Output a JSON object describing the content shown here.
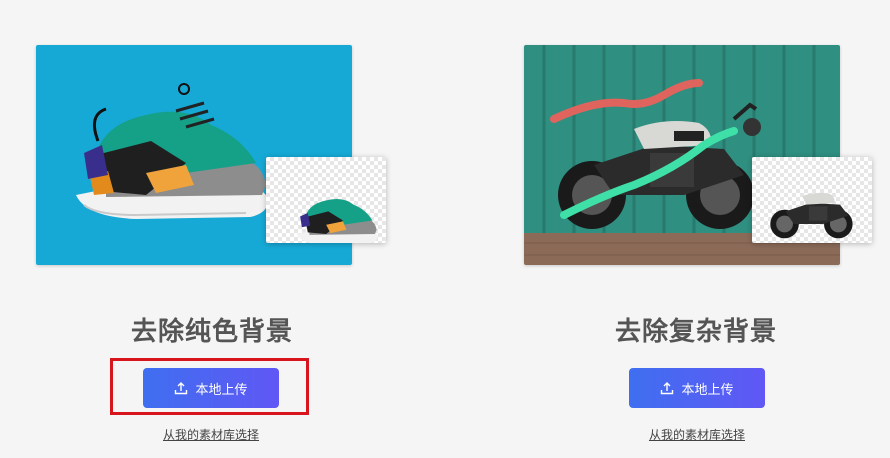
{
  "sections": [
    {
      "title": "去除纯色背景",
      "upload_label": "本地上传",
      "library_link": "从我的素材库选择"
    },
    {
      "title": "去除复杂背景",
      "upload_label": "本地上传",
      "library_link": "从我的素材库选择"
    }
  ],
  "colors": {
    "page_background": "#f5f5f5",
    "sneaker_background": "#16a9d6",
    "button_gradient_start": "#3f6ff0",
    "button_gradient_end": "#6057f4",
    "highlight_border": "#d8141c",
    "title_text": "#555555"
  },
  "icons": {
    "upload": "upload-icon"
  }
}
